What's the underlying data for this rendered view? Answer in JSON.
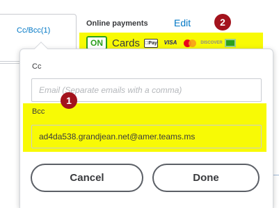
{
  "background": {
    "cc_bcc_link": "Cc/Bcc(1)",
    "online_payments": {
      "label": "Online payments",
      "edit_label": "Edit",
      "toggle_label": "ON",
      "cards_label": "Cards",
      "card_logos": [
        {
          "name": "apple-pay",
          "text": "Pay"
        },
        {
          "name": "visa",
          "text": "VISA"
        },
        {
          "name": "mastercard",
          "text": ""
        },
        {
          "name": "discover",
          "text": "DISCOVER"
        },
        {
          "name": "bank-transfer",
          "text": ""
        }
      ]
    }
  },
  "popover": {
    "cc": {
      "label": "Cc",
      "value": "",
      "placeholder": "Email (Separate emails with a comma)"
    },
    "bcc": {
      "label": "Bcc",
      "value": "ad4da538.grandjean.net@amer.teams.ms"
    },
    "buttons": {
      "cancel": "Cancel",
      "done": "Done"
    }
  },
  "annotations": {
    "badge_1": "1",
    "badge_2": "2"
  },
  "colors": {
    "highlight": "#f8fa05",
    "link": "#0077c5",
    "toggle_green": "#2ca01c",
    "badge": "#a3131d"
  }
}
